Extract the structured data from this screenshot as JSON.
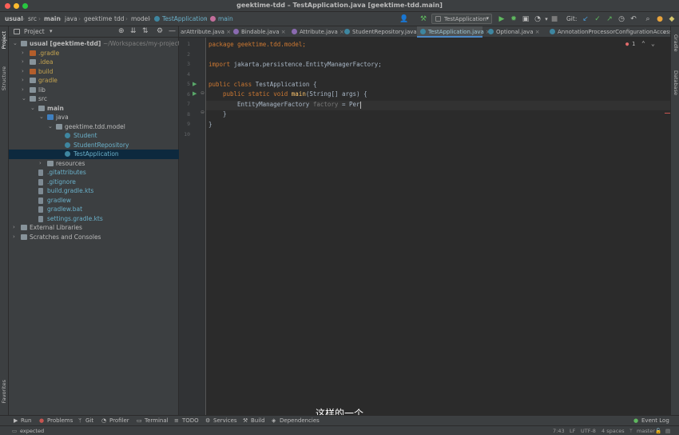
{
  "window": {
    "title": "geektime-tdd – TestApplication.java [geektime-tdd.main]"
  },
  "breadcrumbs": [
    "usual",
    "src",
    "main",
    "java",
    "geektime",
    "tdd",
    "model",
    "TestApplication",
    "main"
  ],
  "toolbar": {
    "run_config": "TestApplication",
    "git_label": "Git:"
  },
  "project": {
    "header": "Project",
    "tree": [
      {
        "label": "usual [geektime-tdd]",
        "suffix": "~/Workspaces/my-projects/t",
        "kind": "module",
        "indent": 0,
        "arrow": "down",
        "color": "#bbbbbb"
      },
      {
        "label": ".gradle",
        "kind": "folder-orange",
        "indent": 1,
        "arrow": "right",
        "color": "#c5a450"
      },
      {
        "label": ".idea",
        "kind": "folder",
        "indent": 1,
        "arrow": "right",
        "color": "#c5a450"
      },
      {
        "label": "build",
        "kind": "folder-orange",
        "indent": 1,
        "arrow": "right",
        "color": "#c5a450"
      },
      {
        "label": "gradle",
        "kind": "folder",
        "indent": 1,
        "arrow": "right",
        "color": "#c5a450"
      },
      {
        "label": "lib",
        "kind": "folder",
        "indent": 1,
        "arrow": "right",
        "color": "#bbbbbb"
      },
      {
        "label": "src",
        "kind": "folder",
        "indent": 1,
        "arrow": "down",
        "color": "#bbbbbb"
      },
      {
        "label": "main",
        "kind": "folder",
        "indent": 2,
        "arrow": "down",
        "color": "#bbbbbb",
        "bold": true
      },
      {
        "label": "java",
        "kind": "folder-blue",
        "indent": 3,
        "arrow": "down",
        "color": "#bbbbbb"
      },
      {
        "label": "geektime.tdd.model",
        "kind": "package",
        "indent": 4,
        "arrow": "down",
        "color": "#bbbbbb"
      },
      {
        "label": "Student",
        "kind": "class",
        "indent": 5,
        "arrow": "",
        "color": "#6ab0c9"
      },
      {
        "label": "StudentRepository",
        "kind": "class",
        "indent": 5,
        "arrow": "",
        "color": "#6ab0c9"
      },
      {
        "label": "TestApplication",
        "kind": "class",
        "indent": 5,
        "arrow": "",
        "color": "#6ab0c9",
        "selected": true
      },
      {
        "label": "resources",
        "kind": "folder",
        "indent": 3,
        "arrow": "right",
        "color": "#bbbbbb"
      },
      {
        "label": ".gitattributes",
        "kind": "file",
        "indent": 2,
        "arrow": "",
        "color": "#6ab0c9"
      },
      {
        "label": ".gitignore",
        "kind": "file",
        "indent": 2,
        "arrow": "",
        "color": "#6ab0c9"
      },
      {
        "label": "build.gradle.kts",
        "kind": "file",
        "indent": 2,
        "arrow": "",
        "color": "#6ab0c9"
      },
      {
        "label": "gradlew",
        "kind": "file",
        "indent": 2,
        "arrow": "",
        "color": "#6ab0c9"
      },
      {
        "label": "gradlew.bat",
        "kind": "file",
        "indent": 2,
        "arrow": "",
        "color": "#6ab0c9"
      },
      {
        "label": "settings.gradle.kts",
        "kind": "file",
        "indent": 2,
        "arrow": "",
        "color": "#6ab0c9"
      },
      {
        "label": "External Libraries",
        "kind": "lib",
        "indent": 0,
        "arrow": "right",
        "color": "#bbbbbb"
      },
      {
        "label": "Scratches and Consoles",
        "kind": "scratch",
        "indent": 0,
        "arrow": "right",
        "color": "#bbbbbb"
      }
    ]
  },
  "tabs": [
    {
      "label": "arAttribute.java"
    },
    {
      "label": "Bindable.java"
    },
    {
      "label": "Attribute.java"
    },
    {
      "label": "StudentRepository.java"
    },
    {
      "label": "TestApplication.java",
      "active": true
    },
    {
      "label": "Optional.java"
    },
    {
      "label": "AnnotationProcessorConfigurationAccessor"
    }
  ],
  "editor": {
    "line_numbers": [
      "1",
      "2",
      "3",
      "4",
      "5",
      "6",
      "7",
      "8",
      "9",
      "10"
    ],
    "code": {
      "l1": "package geektime.tdd.model;",
      "l3": "import jakarta.persistence.EntityManagerFactory;",
      "l5_kw": "public class",
      "l5_rest": " TestApplication {",
      "l6_kw": "public static void",
      "l6_fn": "main",
      "l6_rest": "(String[] args) {",
      "l7_type": "EntityManagerFactory ",
      "l7_hint": "factory",
      "l7_rest": " = Per",
      "l8": "}",
      "l9": "}"
    },
    "warning_count": "1"
  },
  "side_labels": {
    "project": "Project",
    "structure": "Structure",
    "favorites": "Favorites",
    "gradle": "Gradle",
    "database": "Database"
  },
  "bottom_tools": [
    "Run",
    "Problems",
    "Git",
    "Profiler",
    "Terminal",
    "TODO",
    "Services",
    "Build",
    "Dependencies"
  ],
  "event_log": "Event Log",
  "status": {
    "message": "expected",
    "position": "7:43",
    "line_sep": "LF",
    "encoding": "UTF-8",
    "indent": "4 spaces",
    "branch": "master"
  },
  "subtitle": "这样的一个"
}
